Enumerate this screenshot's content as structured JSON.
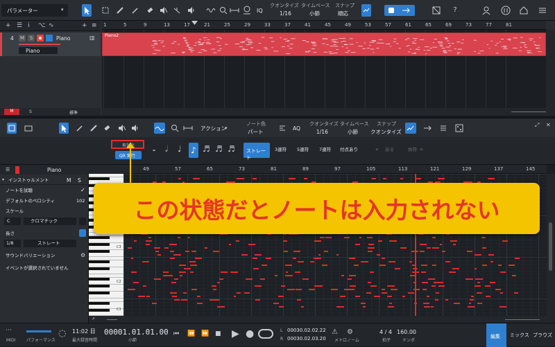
{
  "toolbar": {
    "param_label": "パラメーター",
    "quantize_label": "クオンタイズ",
    "quantize_value": "1/16",
    "timebase_label": "タイムベース",
    "timebase_value": "小節",
    "snap_label": "スナップ",
    "snap_value": "順応",
    "iq_label": "IQ"
  },
  "track": {
    "number": "4",
    "mute": "M",
    "solo": "S",
    "name": "Piano",
    "instrument": "Piano",
    "region_name": "Piano2"
  },
  "arrange_footer": {
    "m": "M",
    "s": "S",
    "view": "標準"
  },
  "arrange_ruler": [
    "1",
    "5",
    "9",
    "13",
    "17",
    "21",
    "25",
    "29",
    "33",
    "37",
    "41",
    "45",
    "49",
    "53",
    "57",
    "61",
    "65",
    "69",
    "73",
    "77",
    "81"
  ],
  "editor_toolbar": {
    "action_label": "アクション",
    "note_color_label": "ノート色",
    "note_color_value": "パート",
    "aq_label": "AQ",
    "quantize_label": "クオンタイズ",
    "quantize_value": "1/16",
    "timebase_label": "タイムベース",
    "timebase_value": "小節",
    "snap_label": "スナップ",
    "snap_value": "クオンタイズ"
  },
  "step_input": {
    "enable_label": "有効化",
    "qr_label": "QR 実行",
    "modes": [
      "ストレート",
      "3連符",
      "5連符",
      "7連符",
      "付点あり"
    ],
    "back_label": "戻る",
    "forward_label": "休符"
  },
  "inspector": {
    "track_name": "Piano",
    "instrument_label": "インストゥルメント",
    "m": "M",
    "s": "S",
    "preview_label": "ノートを試聴",
    "default_velocity_label": "デフォルトのベロシティ",
    "default_velocity_value": "102",
    "scale_label": "スケール",
    "scale_key": "C",
    "scale_type": "クロマチック",
    "length_label": "長さ",
    "length_value": "1/8",
    "length_mode": "ストレート",
    "sound_variation_label": "サウンドバリエーション",
    "no_event_label": "イベントが選択されていません"
  },
  "editor_ruler": [
    "49",
    "57",
    "65",
    "73",
    "81",
    "89",
    "97",
    "105",
    "113",
    "121",
    "129",
    "137",
    "145"
  ],
  "piano_labels": [
    "C3",
    "C2",
    "C1"
  ],
  "callout": {
    "text": "この状態だとノートは入力されない",
    "bg_color": "#f5c400",
    "text_color": "#e53525",
    "highlight_color": "#e82b2b"
  },
  "transport": {
    "midi_label": "MIDI",
    "perf_label": "パフォーマンス",
    "time": "11:02 日",
    "time_sub": "最大録音時間",
    "position": "00001.01.01.00",
    "position_sub": "小節",
    "loop_start": "00030.02.02.22",
    "loop_end": "00030.02.03.20",
    "metronome_label": "メトロノーム",
    "time_sig": "4 / 4",
    "time_sig_label": "拍子",
    "tempo": "160.00",
    "tempo_label": "テンポ",
    "edit_tab": "編集",
    "mix_tab": "ミックス",
    "browse_tab": "ブラウズ"
  },
  "colors": {
    "accent": "#2f7fd0",
    "note": "#e02b2b",
    "region": "#d8434e"
  }
}
